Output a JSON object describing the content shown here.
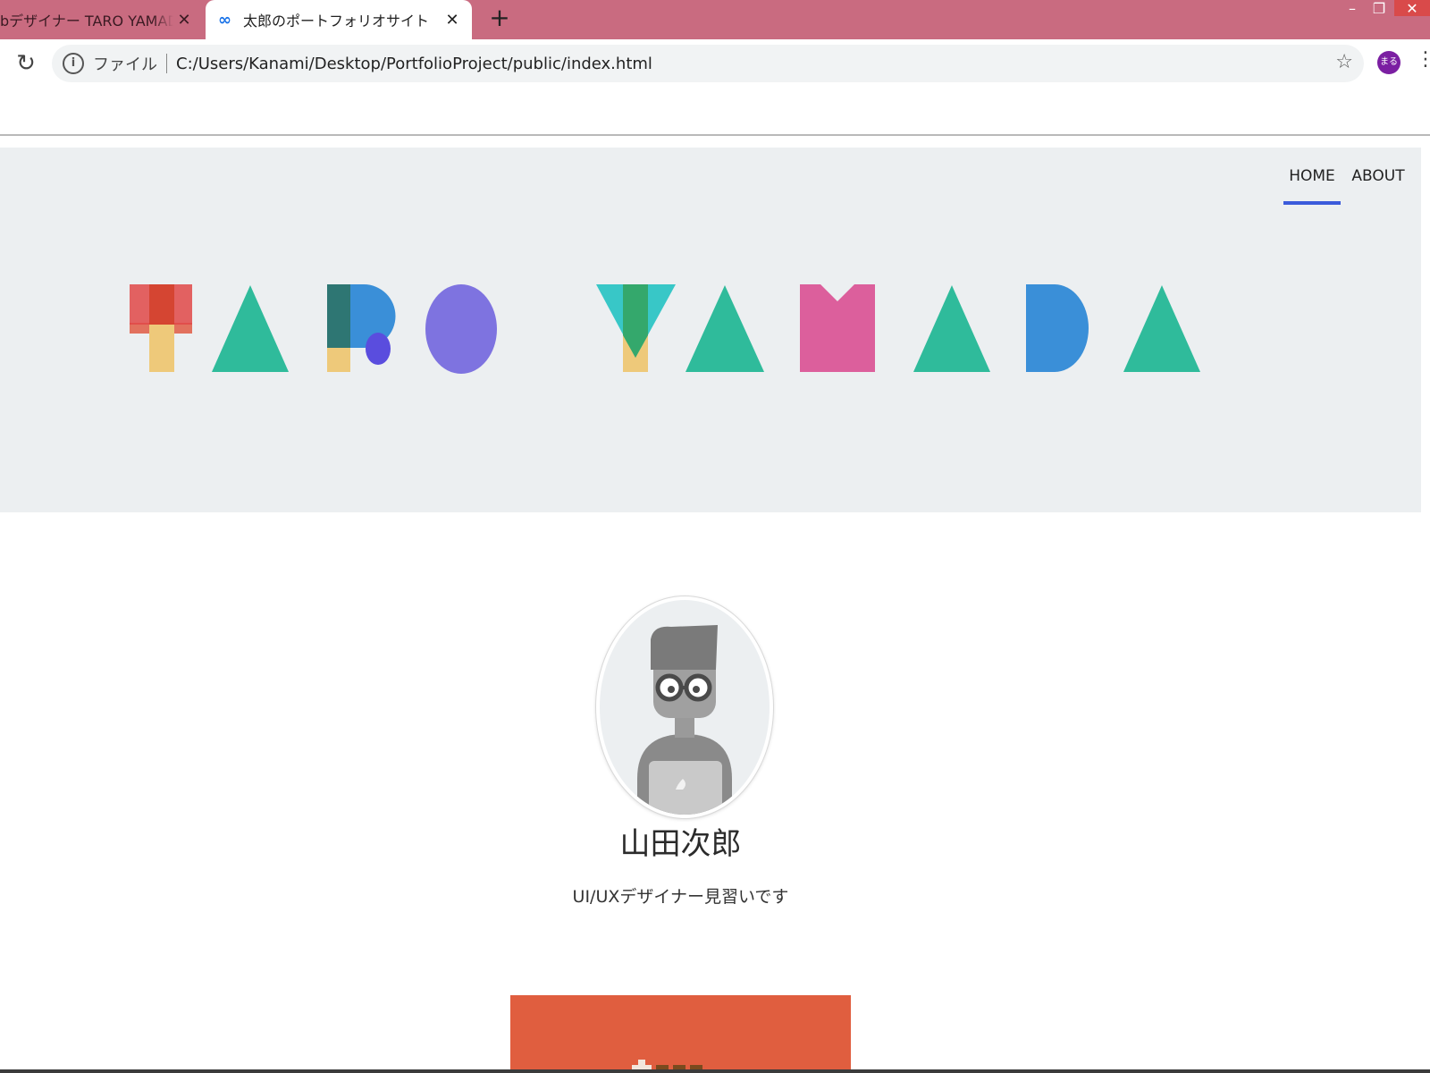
{
  "browser": {
    "tabs": [
      {
        "title": "bデザイナー TARO YAMADA ポ",
        "active": false
      },
      {
        "title": "太郎のポートフォリオサイト",
        "active": true
      }
    ],
    "new_tab_label": "+",
    "security_chip": "ファイル",
    "url": "C:/Users/Kanami/Desktop/PortfolioProject/public/index.html",
    "profile_badge": "まる"
  },
  "page": {
    "nav": {
      "home": "HOME",
      "about": "ABOUT"
    },
    "logo_text": "TARO YAMADA",
    "profile": {
      "name": "山田次郎",
      "tagline": "UI/UXデザイナー見習いです"
    }
  },
  "colors": {
    "tabstrip": "#c96b80",
    "nav_active_underline": "#3b5bdb",
    "hero_background": "#eceff1",
    "card": "#e05e3f"
  }
}
